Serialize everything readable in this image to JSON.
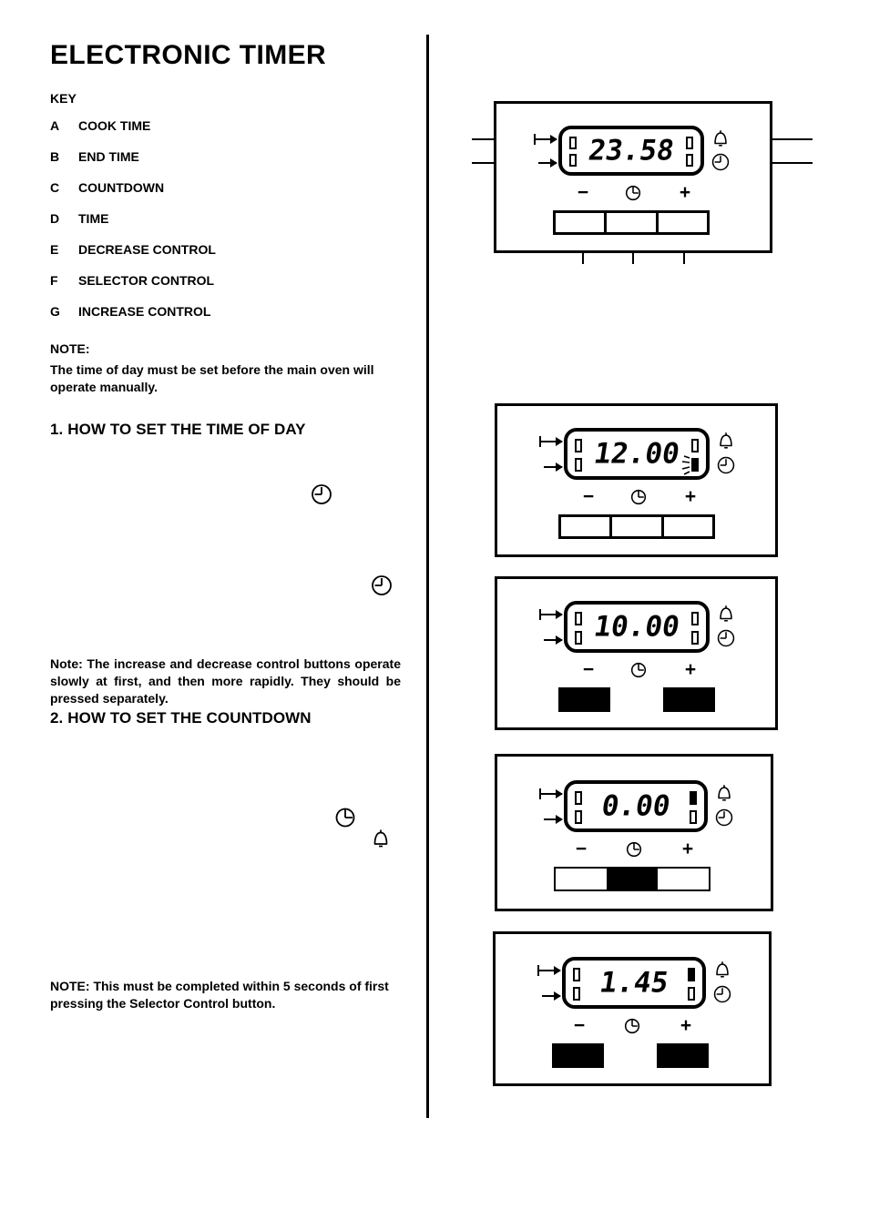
{
  "document": {
    "title": "ELECTRONIC TIMER",
    "key_heading": "KEY",
    "key_items": [
      {
        "letter": "A",
        "label": "COOK TIME"
      },
      {
        "letter": "B",
        "label": "END TIME"
      },
      {
        "letter": "C",
        "label": "COUNTDOWN"
      },
      {
        "letter": "D",
        "label": "TIME"
      },
      {
        "letter": "E",
        "label": "DECREASE CONTROL"
      },
      {
        "letter": "F",
        "label": "SELECTOR CONTROL"
      },
      {
        "letter": "G",
        "label": "INCREASE CONTROL"
      }
    ],
    "note_top": {
      "heading": "NOTE:",
      "body": "The time of day must be set before the main oven will operate manually."
    },
    "section_1": "1.  HOW TO SET THE TIME OF DAY",
    "note_buttons": "Note: The increase and decrease control buttons operate slowly at first, and then more rapidly. They should be pressed separately.",
    "section_2": "2.  HOW TO SET THE COUNTDOWN",
    "note_5sec": "NOTE:  This must be completed within 5 seconds of first pressing the Selector Control button."
  },
  "symbols": {
    "minus": "−",
    "plus": "+",
    "selector_icon": "clock-selector-icon",
    "bell_icon": "bell-icon",
    "clock_icon": "clock-icon",
    "cook_time_arrow": "cook-time-arrow-icon",
    "end_time_arrow": "end-time-arrow-icon"
  },
  "diagrams": [
    {
      "id": "timer-diagram-1",
      "display_value": "23.58",
      "flashing": false,
      "markers": {
        "top_left": "off",
        "bottom_left": "off",
        "top_right": "off",
        "bottom_right": "off"
      },
      "buttons": {
        "decrease": "off",
        "selector": "off",
        "increase": "off"
      },
      "callouts": true
    },
    {
      "id": "timer-diagram-2",
      "display_value": "12.00",
      "flashing": true,
      "markers": {
        "top_left": "off",
        "bottom_left": "off",
        "top_right": "off",
        "bottom_right": "flashing"
      },
      "buttons": {
        "decrease": "off",
        "selector": "off",
        "increase": "off"
      },
      "callouts": false
    },
    {
      "id": "timer-diagram-3",
      "display_value": "10.00",
      "flashing": false,
      "markers": {
        "top_left": "off",
        "bottom_left": "off",
        "top_right": "off",
        "bottom_right": "off"
      },
      "buttons": {
        "decrease": "on",
        "selector": "off",
        "increase": "on"
      },
      "callouts": false
    },
    {
      "id": "timer-diagram-4",
      "display_value": "0.00",
      "flashing": false,
      "markers": {
        "top_left": "off",
        "bottom_left": "off",
        "top_right": "on",
        "bottom_right": "off"
      },
      "buttons": {
        "decrease": "off",
        "selector": "on",
        "increase": "off"
      },
      "callouts": false
    },
    {
      "id": "timer-diagram-5",
      "display_value": "1.45",
      "flashing": false,
      "markers": {
        "top_left": "off",
        "bottom_left": "off",
        "top_right": "on",
        "bottom_right": "off"
      },
      "buttons": {
        "decrease": "on",
        "selector": "off",
        "increase": "on"
      },
      "callouts": false
    }
  ],
  "colors": {
    "ink": "#000000",
    "paper": "#ffffff"
  }
}
